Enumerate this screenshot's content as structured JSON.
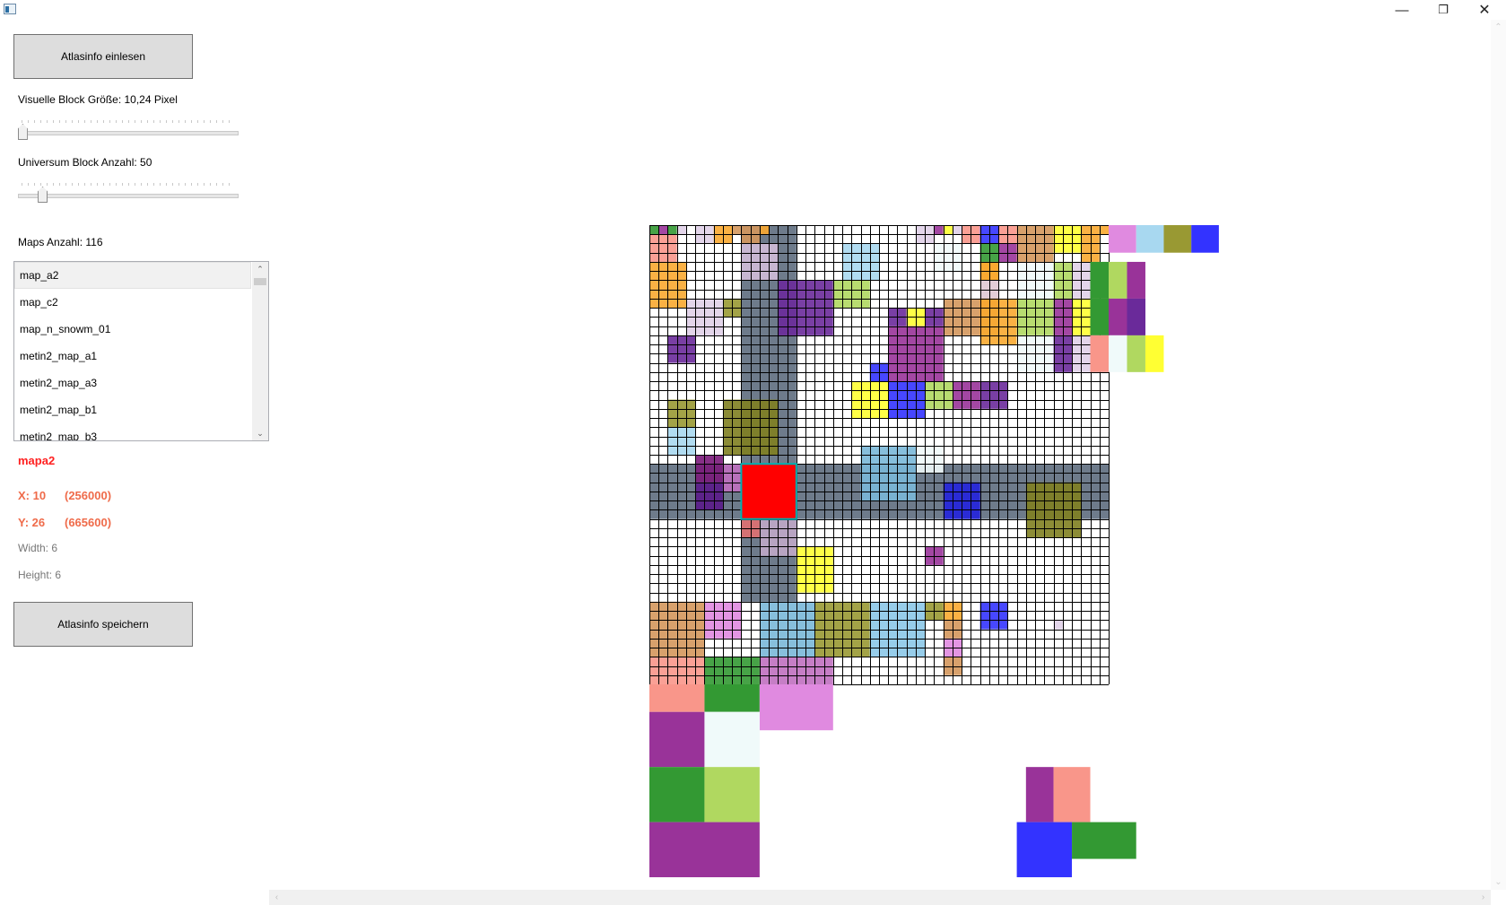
{
  "window": {
    "minimize_icon": "minimize-icon",
    "maximize_icon": "restore-icon",
    "close_icon": "close-icon",
    "minimize_glyph": "—",
    "maximize_glyph": "❐",
    "close_glyph": "✕"
  },
  "controls": {
    "load_button": "Atlasinfo einlesen",
    "block_size_label": "Visuelle Block Größe: 10,24 Pixel",
    "block_size_value": 0.02,
    "universe_label": "Universum Block Anzahl: 50",
    "universe_value": 0.11,
    "maps_count_label": "Maps Anzahl: 116",
    "save_button": "Atlasinfo speichern"
  },
  "map_list": {
    "items": [
      "map_a2",
      "map_c2",
      "map_n_snowm_01",
      "metin2_map_a1",
      "metin2_map_a3",
      "metin2_map_b1",
      "metin2_map_b3"
    ],
    "selected_index": 0,
    "scroll_up_glyph": "⌃",
    "scroll_down_glyph": "⌄"
  },
  "selection": {
    "name": "mapa2",
    "x_label": "X: 10",
    "x_world": "(256000)",
    "y_label": "Y: 26",
    "y_world": "(665600)",
    "width_label": "Width: 6",
    "height_label": "Height: 6"
  },
  "atlas": {
    "grid_cols": 50,
    "grid_rows": 50,
    "colors": {
      "grid_line": "#000000",
      "road": "#6e7b8b",
      "selected": "#ff0000",
      "selected_outline": "#00b0b0"
    }
  }
}
